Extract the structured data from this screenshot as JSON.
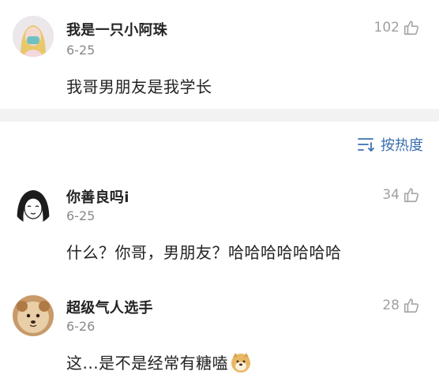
{
  "comments_top": [
    {
      "username": "我是一只小阿珠",
      "date": "6-25",
      "text": "我哥男朋友是我学长",
      "likes": "102"
    }
  ],
  "sort": {
    "label": "按热度"
  },
  "comments": [
    {
      "username": "你善良吗i",
      "date": "6-25",
      "text": "什么？你哥，男朋友？哈哈哈哈哈哈哈",
      "likes": "34"
    },
    {
      "username": "超级气人选手",
      "date": "6-26",
      "text": "这...是不是经常有糖嗑",
      "likes": "28"
    }
  ],
  "icons": {
    "like": "thumbs-up-icon",
    "sort": "sort-lines-icon",
    "emoji": "doge-emoji-icon"
  },
  "colors": {
    "link": "#3a6fb0",
    "meta": "#8a8a8a",
    "divider": "#f2f2f2"
  }
}
